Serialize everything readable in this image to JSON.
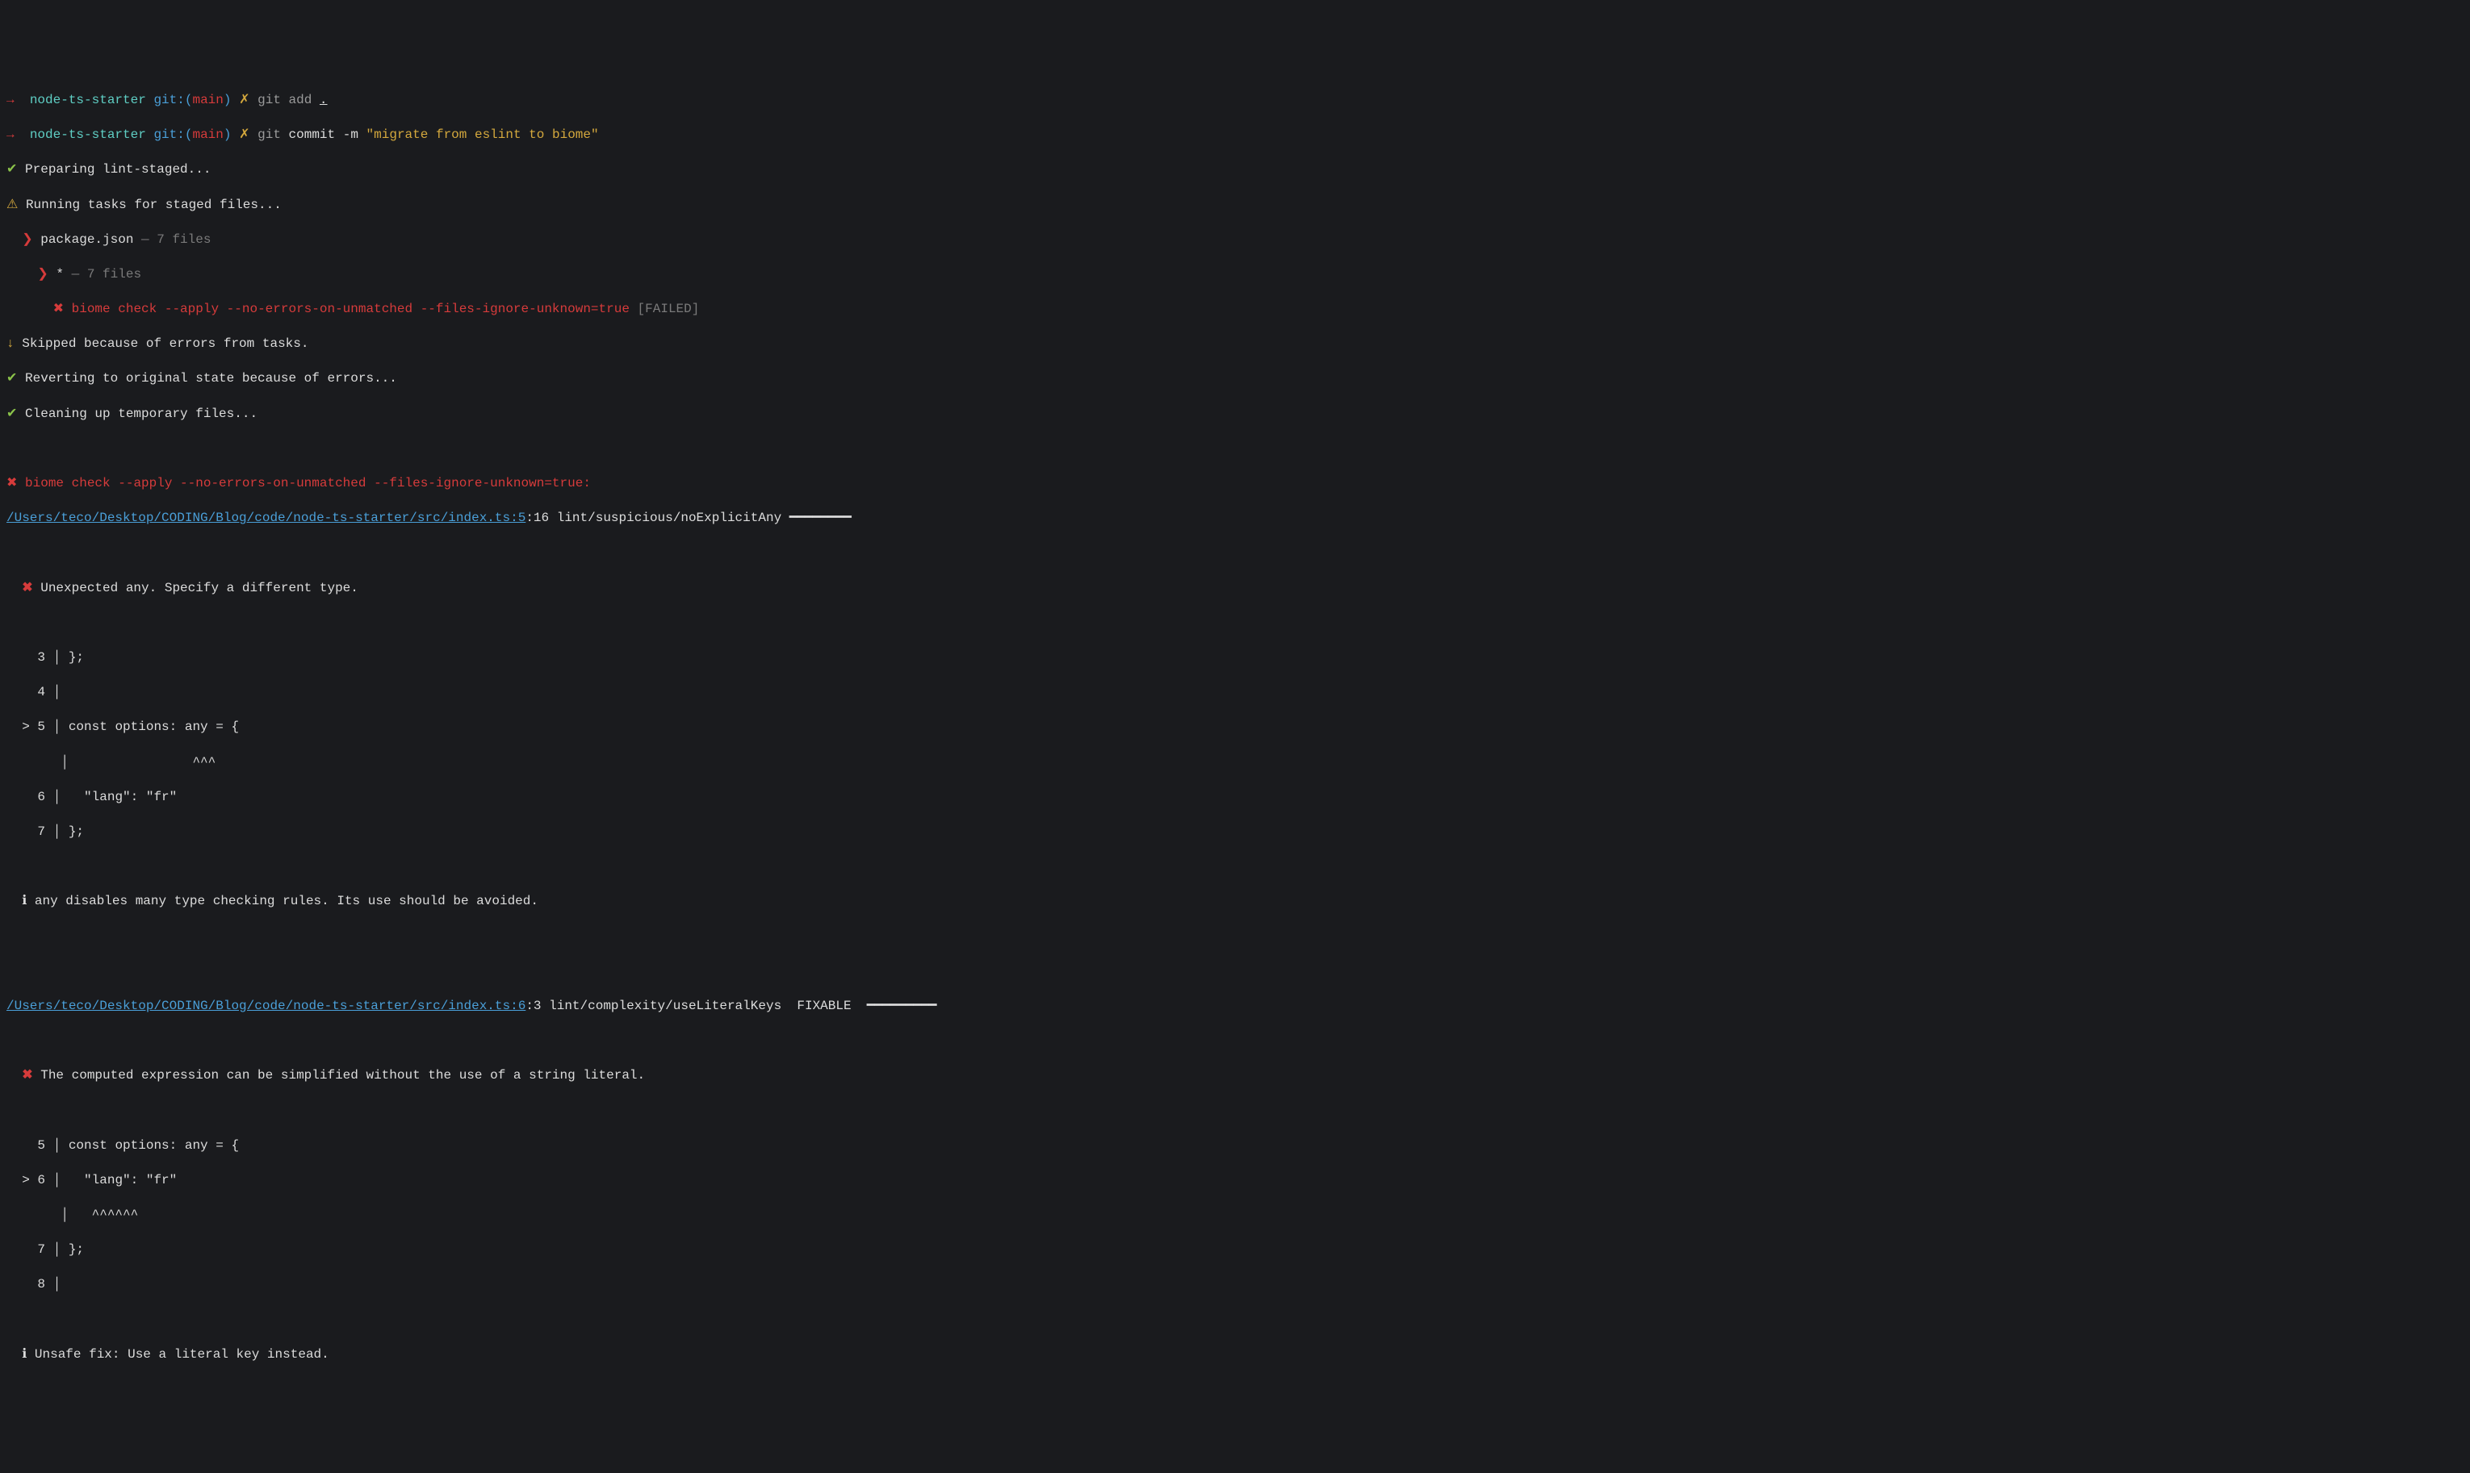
{
  "prompt1": {
    "arrow": "→",
    "dir": "node-ts-starter",
    "git_label": "git:(",
    "branch": "main",
    "git_close": ")",
    "x": "✗",
    "cmd": "git add ",
    "arg": "."
  },
  "prompt2": {
    "arrow": "→",
    "dir": "node-ts-starter",
    "git_label": "git:(",
    "branch": "main",
    "git_close": ")",
    "x": "✗",
    "cmd_git": "git",
    "cmd_rest": " commit -m ",
    "msg": "\"migrate from eslint to biome\""
  },
  "steps": {
    "preparing": {
      "mark": "✔",
      "text": " Preparing lint-staged..."
    },
    "running": {
      "mark": "⚠",
      "text": " Running tasks for staged files..."
    },
    "pkg": {
      "mark": "❯",
      "file": "package.json",
      "dash": " — ",
      "count": "7 files"
    },
    "star": {
      "mark": "❯",
      "glob": "*",
      "dash": " — ",
      "count": "7 files"
    },
    "biome_fail": {
      "mark": "✖",
      "cmd": "biome check --apply --no-errors-on-unmatched --files-ignore-unknown=true",
      "status": "[FAILED]"
    },
    "skipped": {
      "mark": "↓",
      "text": " Skipped because of errors from tasks."
    },
    "reverting": {
      "mark": "✔",
      "text": " Reverting to original state because of errors..."
    },
    "cleaning": {
      "mark": "✔",
      "text": " Cleaning up temporary files..."
    }
  },
  "error_header": {
    "mark": "✖",
    "cmd": "biome check --apply --no-errors-on-unmatched --files-ignore-unknown=true:"
  },
  "issue1": {
    "path": "/Users/teco/Desktop/CODING/Blog/code/node-ts-starter/src/index.ts:5",
    "loc": ":16 lint/suspicious/noExplicitAny ",
    "rule_line": "━━━━━━━━",
    "err_mark": "✖",
    "err_msg": " Unexpected any. Specify a different type.",
    "l3": {
      "num": "    3",
      "pipe": " │ ",
      "code": "};"
    },
    "l4": {
      "num": "    4",
      "pipe": " │ ",
      "code": ""
    },
    "l5": {
      "gt": "  > ",
      "num": "5",
      "pipe": " │ ",
      "code": "const options: any = {"
    },
    "l5p": {
      "sp": "      ",
      "pipe": " │ ",
      "carets": "               ^^^"
    },
    "l6": {
      "num": "    6",
      "pipe": " │ ",
      "code": "  \"lang\": \"fr\""
    },
    "l7": {
      "num": "    7",
      "pipe": " │ ",
      "code": "};"
    },
    "info_mark": "ℹ",
    "info": " any disables many type checking rules. Its use should be avoided."
  },
  "issue2": {
    "path": "/Users/teco/Desktop/CODING/Blog/code/node-ts-starter/src/index.ts:6",
    "loc": ":3 lint/complexity/useLiteralKeys  FIXABLE  ",
    "rule_line": "━━━━━━━━━",
    "err_mark": "✖",
    "err_msg": " The computed expression can be simplified without the use of a string literal.",
    "l5": {
      "num": "    5",
      "pipe": " │ ",
      "code": "const options: any = {"
    },
    "l6": {
      "gt": "  > ",
      "num": "6",
      "pipe": " │ ",
      "code": "  \"lang\": \"fr\""
    },
    "l6p": {
      "sp": "      ",
      "pipe": " │ ",
      "carets": "  ^^^^^^"
    },
    "l7": {
      "num": "    7",
      "pipe": " │ ",
      "code": "};"
    },
    "l8": {
      "num": "    8",
      "pipe": " │ ",
      "code": ""
    },
    "info_mark": "ℹ",
    "info": " Unsafe fix: Use a literal key instead."
  }
}
